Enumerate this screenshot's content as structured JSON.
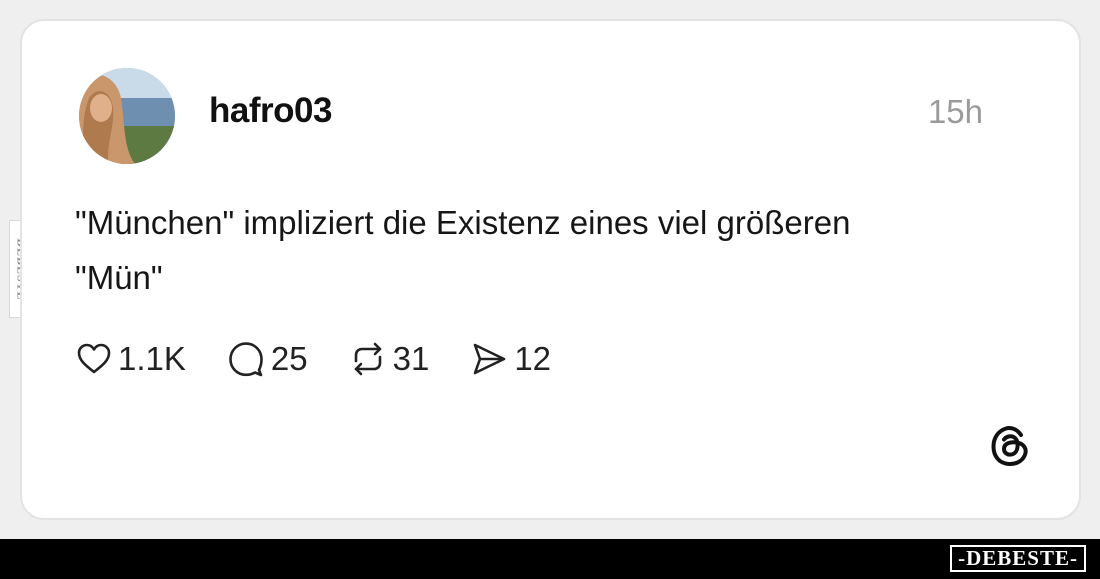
{
  "post": {
    "username": "hafro03",
    "timestamp": "15h",
    "text": "\"München\" impliziert die Existenz eines viel größeren \"Mün\"",
    "avatar_icon": "profile-photo"
  },
  "actions": {
    "likes": {
      "icon": "heart-icon",
      "count": "1.1K"
    },
    "comments": {
      "icon": "comment-bubble-icon",
      "count": "25"
    },
    "reposts": {
      "icon": "repost-icon",
      "count": "31"
    },
    "shares": {
      "icon": "send-icon",
      "count": "12"
    }
  },
  "branding": {
    "platform_icon": "threads-logo-icon",
    "side_watermark": "DEBESTE",
    "footer_logo": "-DEBESTE-"
  },
  "colors": {
    "card_background": "#ffffff",
    "card_border": "#e3e3e3",
    "text": "#161616",
    "timestamp": "#9a9a9a",
    "footer_bar": "#000000"
  }
}
